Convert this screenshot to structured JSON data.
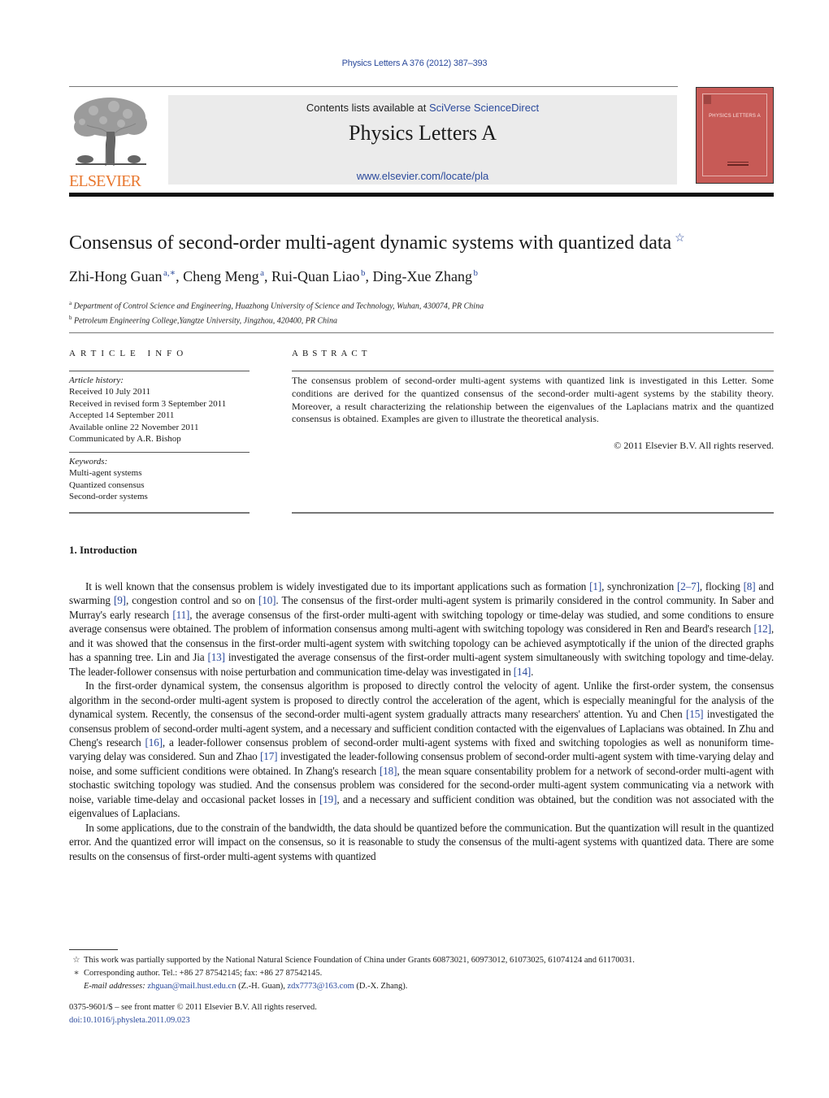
{
  "header": {
    "journal_ref": "Physics Letters A 376 (2012) 387–393",
    "contents_prefix": "Contents lists available at ",
    "contents_link": "SciVerse ScienceDirect",
    "journal_title": "Physics Letters A",
    "journal_url": "www.elsevier.com/locate/pla",
    "publisher_logo_text": "ELSEVIER",
    "cover_title": "PHYSICS LETTERS A",
    "colors": {
      "link": "#2b4a9c",
      "elsevier_orange": "#e8772e",
      "cover_red": "#c75a56"
    }
  },
  "article": {
    "title": "Consensus of second-order multi-agent dynamic systems with quantized data",
    "title_note_mark": "☆",
    "authors": [
      {
        "name": "Zhi-Hong Guan",
        "sup": "a,∗"
      },
      {
        "name": "Cheng Meng",
        "sup": "a"
      },
      {
        "name": "Rui-Quan Liao",
        "sup": "b"
      },
      {
        "name": "Ding-Xue Zhang",
        "sup": "b"
      }
    ],
    "affiliations": [
      {
        "mark": "a",
        "text": "Department of Control Science and Engineering, Huazhong University of Science and Technology, Wuhan, 430074, PR China"
      },
      {
        "mark": "b",
        "text": "Petroleum Engineering College,Yangtze University, Jingzhou, 420400, PR China"
      }
    ]
  },
  "article_info": {
    "heading": "ARTICLE INFO",
    "history_label": "Article history:",
    "history": [
      "Received 10 July 2011",
      "Received in revised form 3 September 2011",
      "Accepted 14 September 2011",
      "Available online 22 November 2011",
      "Communicated by A.R. Bishop"
    ],
    "keywords_label": "Keywords:",
    "keywords": [
      "Multi-agent systems",
      "Quantized consensus",
      "Second-order systems"
    ]
  },
  "abstract": {
    "heading": "ABSTRACT",
    "text": "The consensus problem of second-order multi-agent systems with quantized link is investigated in this Letter. Some conditions are derived for the quantized consensus of the second-order multi-agent systems by the stability theory. Moreover, a result characterizing the relationship between the eigenvalues of the Laplacians matrix and the quantized consensus is obtained. Examples are given to illustrate the theoretical analysis.",
    "copyright": "© 2011 Elsevier B.V. All rights reserved."
  },
  "intro": {
    "heading": "1.  Introduction",
    "paragraphs": [
      [
        {
          "t": "It is well known that the consensus problem is widely investigated due to its important applications such as formation "
        },
        {
          "c": "[1]"
        },
        {
          "t": ", synchronization "
        },
        {
          "c": "[2–7]"
        },
        {
          "t": ", flocking "
        },
        {
          "c": "[8]"
        },
        {
          "t": " and swarming "
        },
        {
          "c": "[9]"
        },
        {
          "t": ", congestion control and so on "
        },
        {
          "c": "[10]"
        },
        {
          "t": ". The consensus of the first-order multi-agent system is primarily considered in the control community. In Saber and Murray's early research "
        },
        {
          "c": "[11]"
        },
        {
          "t": ", the average consensus of the first-order multi-agent with switching topology or time-delay was studied, and some conditions to ensure average consensus were obtained. The problem of information consensus among multi-agent with switching topology was considered in Ren and Beard's research "
        },
        {
          "c": "[12]"
        },
        {
          "t": ", and it was showed that the consensus in the first-order multi-agent system with switching topology can be achieved asymptotically if the union of the directed graphs has a spanning tree. Lin and Jia "
        },
        {
          "c": "[13]"
        },
        {
          "t": " investigated the average consensus of the first-order multi-agent system simultaneously with switching topology and time-delay. The leader-follower consensus with noise perturbation and communication time-delay was investigated in "
        },
        {
          "c": "[14]"
        },
        {
          "t": "."
        }
      ],
      [
        {
          "t": "In the first-order dynamical system, the consensus algorithm is proposed to directly control the velocity of agent. Unlike the first-order system, the consensus algorithm in the second-order multi-agent system is proposed to directly control the acceleration of the agent, which is especially meaningful for the analysis of the dynamical system. Recently, the consensus of the second-order multi-agent system gradually attracts many researchers' attention. Yu and Chen "
        },
        {
          "c": "[15]"
        },
        {
          "t": " investigated the consensus problem of second-order multi-agent system, and a necessary and sufficient condition contacted with the eigenvalues of Laplacians was obtained. In Zhu and Cheng's research "
        },
        {
          "c": "[16]"
        },
        {
          "t": ", a leader-follower consensus problem of second-order multi-agent systems with fixed and switching topologies as well as nonuniform time-varying delay was considered. Sun and Zhao "
        },
        {
          "c": "[17]"
        },
        {
          "t": " investigated the leader-following consensus problem of second-order multi-agent system with time-varying delay and noise, and some sufficient conditions were obtained. In Zhang's research "
        },
        {
          "c": "[18]"
        },
        {
          "t": ", the mean square consentability problem for a network of second-order multi-agent with stochastic switching topology was studied. And the consensus problem was considered for the second-order multi-agent system communicating via a network with noise, variable time-delay and occasional packet losses in "
        },
        {
          "c": "[19]"
        },
        {
          "t": ", and a necessary and sufficient condition was obtained, but the condition was not associated with the eigenvalues of Laplacians."
        }
      ],
      [
        {
          "t": "In some applications, due to the constrain of the bandwidth, the data should be quantized before the communication. But the quantization will result in the quantized error. And the quantized error will impact on the consensus, so it is reasonable to study the consensus of the multi-agent systems with quantized data. There are some results on the consensus of first-order multi-agent systems with quantized"
        }
      ]
    ]
  },
  "footnotes": {
    "funding_mark": "☆",
    "funding": "This work was partially supported by the National Natural Science Foundation of China under Grants 60873021, 60973012, 61073025, 61074124 and 61170031.",
    "corresponding_mark": "∗",
    "corresponding": "Corresponding author. Tel.: +86 27 87542145; fax: +86 27 87542145.",
    "email_label": "E-mail addresses:",
    "email1": "zhguan@mail.hust.edu.cn",
    "email1_owner": " (Z.-H. Guan), ",
    "email2": "zdx7773@163.com",
    "email2_owner": " (D.-X. Zhang).",
    "front_matter": "0375-9601/$ – see front matter  © 2011 Elsevier B.V. All rights reserved.",
    "doi": "doi:10.1016/j.physleta.2011.09.023"
  }
}
